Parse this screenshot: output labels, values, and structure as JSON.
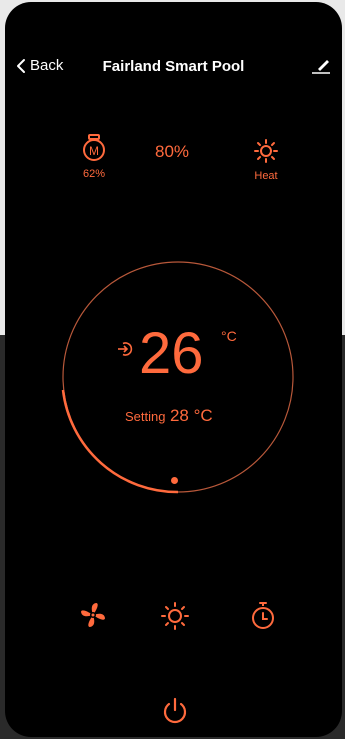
{
  "header": {
    "back_label": "Back",
    "title": "Fairland Smart Pool"
  },
  "stats": {
    "mode_value": "62%",
    "center_value": "80%",
    "heat_label": "Heat"
  },
  "temperature": {
    "current": "26",
    "unit": "°C",
    "setting_label": "Setting",
    "setting_value": "28 °C"
  },
  "colors": {
    "accent": "#ff6a3d",
    "background": "#000000",
    "text": "#ffffff"
  },
  "icons": {
    "back": "chevron-left-icon",
    "edit": "pencil-icon",
    "mode": "mode-m-icon",
    "heat": "sun-icon",
    "inlet": "inlet-arrow-icon",
    "fan": "fan-icon",
    "timer": "timer-icon",
    "power": "power-icon"
  }
}
